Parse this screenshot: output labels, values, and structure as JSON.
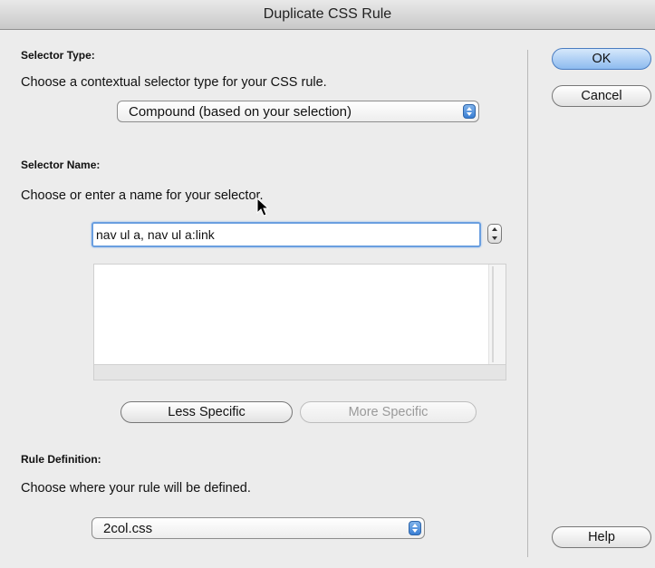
{
  "window": {
    "title": "Duplicate CSS Rule"
  },
  "selector_type": {
    "heading": "Selector Type:",
    "description": "Choose a contextual selector type for your CSS rule.",
    "selected": "Compound (based on your selection)"
  },
  "selector_name": {
    "heading": "Selector Name:",
    "description": "Choose or enter a name for your selector.",
    "value": "nav ul a, nav ul a:link",
    "less_specific": "Less Specific",
    "more_specific": "More Specific"
  },
  "rule_definition": {
    "heading": "Rule Definition:",
    "description": "Choose where your rule will be defined.",
    "selected": "2col.css"
  },
  "buttons": {
    "ok": "OK",
    "cancel": "Cancel",
    "help": "Help"
  }
}
